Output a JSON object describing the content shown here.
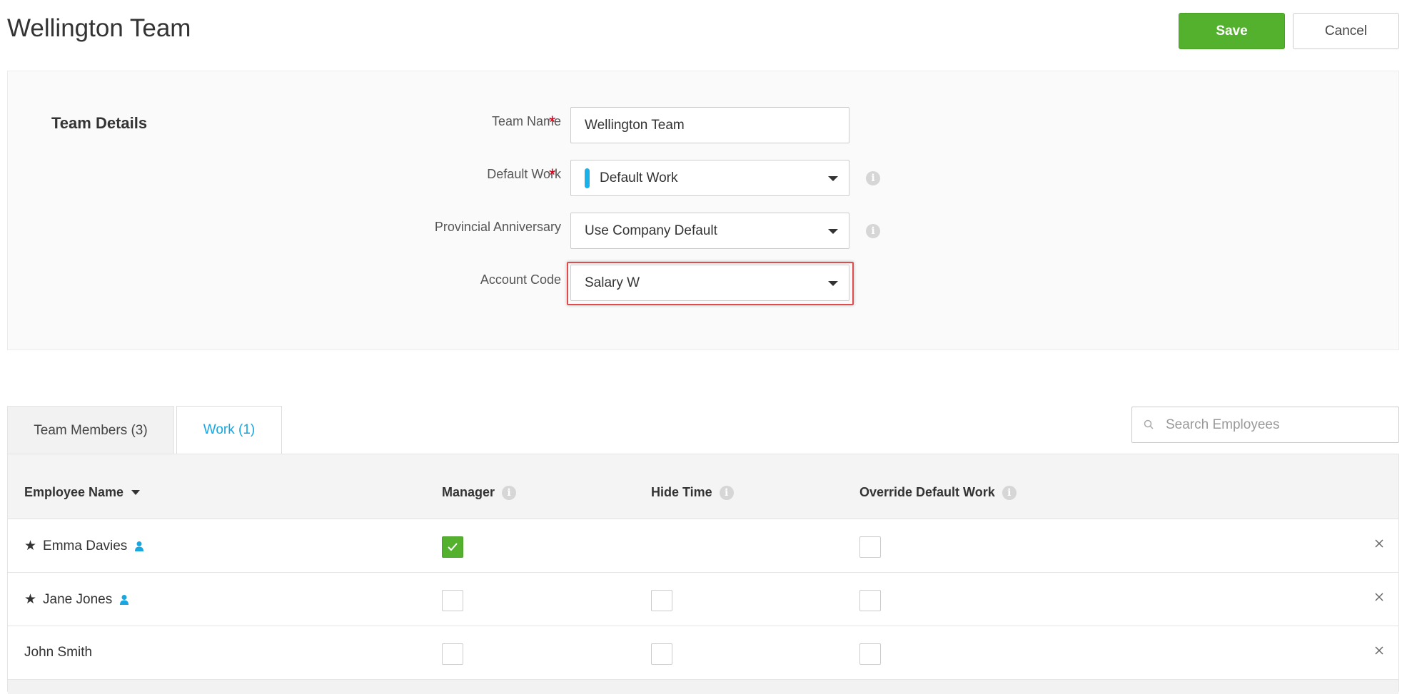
{
  "page": {
    "title": "Wellington Team"
  },
  "actions": {
    "save_label": "Save",
    "cancel_label": "Cancel"
  },
  "team_details": {
    "section_title": "Team Details",
    "fields": {
      "team_name": {
        "label": "Team Name",
        "value": "Wellington Team",
        "required": true
      },
      "default_work": {
        "label": "Default Work",
        "value": "Default Work",
        "required": true,
        "color": "#1ab0e8"
      },
      "provincial_anniversary": {
        "label": "Provincial Anniversary",
        "value": "Use Company Default",
        "required": false
      },
      "account_code": {
        "label": "Account Code",
        "value": "Salary W",
        "required": false
      }
    },
    "required_marker": "*"
  },
  "tabs": [
    {
      "label": "Team Members (3)",
      "active": false
    },
    {
      "label": "Work (1)",
      "active": true
    }
  ],
  "search": {
    "placeholder": "Search Employees",
    "value": ""
  },
  "table": {
    "columns": {
      "employee_name": "Employee Name",
      "manager": "Manager",
      "hide_time": "Hide Time",
      "override_default_work": "Override Default Work"
    },
    "rows": [
      {
        "name": "Emma Davies",
        "starred": true,
        "user_icon": true,
        "manager": true,
        "hide_time": null,
        "override_default_work": false
      },
      {
        "name": "Jane Jones",
        "starred": true,
        "user_icon": true,
        "manager": false,
        "hide_time": false,
        "override_default_work": false
      },
      {
        "name": "John Smith",
        "starred": false,
        "user_icon": false,
        "manager": false,
        "hide_time": false,
        "override_default_work": false
      }
    ]
  },
  "icons": {
    "star": "★",
    "info": "i"
  },
  "colors": {
    "save_green": "#53b12e",
    "accent_blue": "#1aa6e0",
    "required_red": "#d0021b",
    "highlight_red": "#e04b4b"
  }
}
